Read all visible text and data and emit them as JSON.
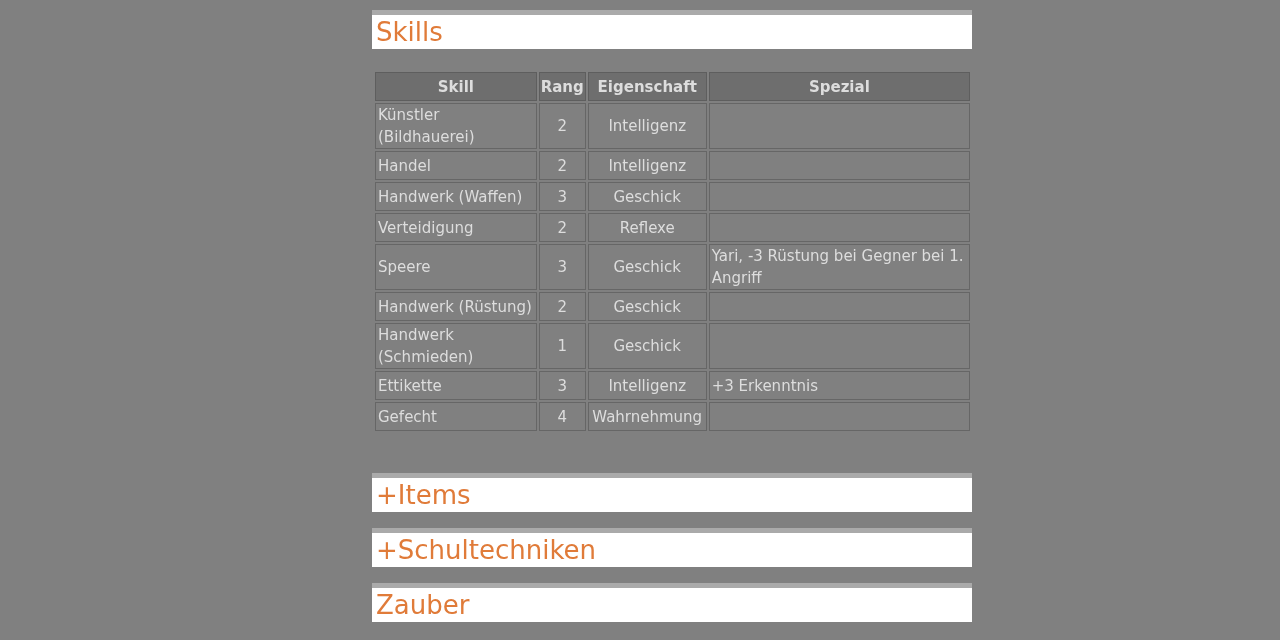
{
  "sections": [
    {
      "title": "Skills",
      "table": {
        "columns": [
          "Skill",
          "Rang",
          "Eigenschaft",
          "Spezial"
        ],
        "rows": [
          [
            "Künstler (Bildhauerei)",
            "2",
            "Intelligenz",
            ""
          ],
          [
            "Handel",
            "2",
            "Intelligenz",
            ""
          ],
          [
            "Handwerk (Waffen)",
            "3",
            "Geschick",
            ""
          ],
          [
            "Verteidigung",
            "2",
            "Reflexe",
            ""
          ],
          [
            "Speere",
            "3",
            "Geschick",
            "Yari, -3 Rüstung bei Gegner bei 1. Angriff"
          ],
          [
            "Handwerk (Rüstung)",
            "2",
            "Geschick",
            ""
          ],
          [
            "Handwerk (Schmieden)",
            "1",
            "Geschick",
            ""
          ],
          [
            "Ettikette",
            "3",
            "Intelligenz",
            "+3 Erkenntnis"
          ],
          [
            "Gefecht",
            "4",
            "Wahrnehmung",
            ""
          ]
        ]
      }
    },
    {
      "title": "+Items"
    },
    {
      "title": "+Schultechniken"
    },
    {
      "title": "Zauber"
    }
  ]
}
